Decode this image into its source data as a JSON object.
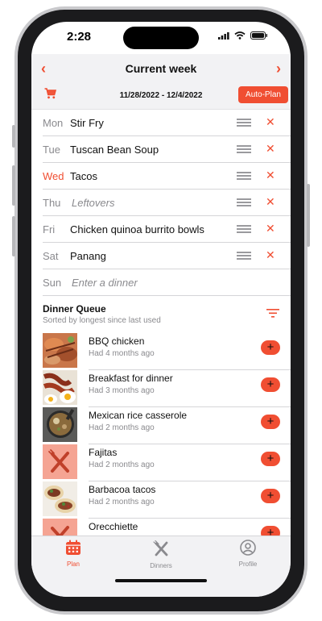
{
  "status": {
    "time": "2:28"
  },
  "nav": {
    "title": "Current week"
  },
  "week": {
    "range": "11/28/2022 - 12/4/2022",
    "autoplan": "Auto-Plan"
  },
  "days": [
    {
      "day": "Mon",
      "dinner": "Stir Fry"
    },
    {
      "day": "Tue",
      "dinner": "Tuscan Bean Soup"
    },
    {
      "day": "Wed",
      "dinner": "Tacos"
    },
    {
      "day": "Thu",
      "dinner": "Leftovers"
    },
    {
      "day": "Fri",
      "dinner": "Chicken quinoa burrito bowls"
    },
    {
      "day": "Sat",
      "dinner": "Panang"
    },
    {
      "day": "Sun",
      "placeholder": "Enter a dinner"
    }
  ],
  "queue": {
    "title": "Dinner Queue",
    "subtitle": "Sorted by longest since last used",
    "items": [
      {
        "name": "BBQ chicken",
        "when": "Had 4 months ago"
      },
      {
        "name": "Breakfast for dinner",
        "when": "Had 3 months ago"
      },
      {
        "name": "Mexican rice casserole",
        "when": "Had 2 months ago"
      },
      {
        "name": "Fajitas",
        "when": "Had 2 months ago"
      },
      {
        "name": "Barbacoa tacos",
        "when": "Had 2 months ago"
      },
      {
        "name": "Orecchiette",
        "when": ""
      }
    ]
  },
  "tabs": {
    "plan": "Plan",
    "dinners": "Dinners",
    "profile": "Profile"
  },
  "colors": {
    "accent": "#f04e32",
    "bar": "#f2f2f4"
  }
}
